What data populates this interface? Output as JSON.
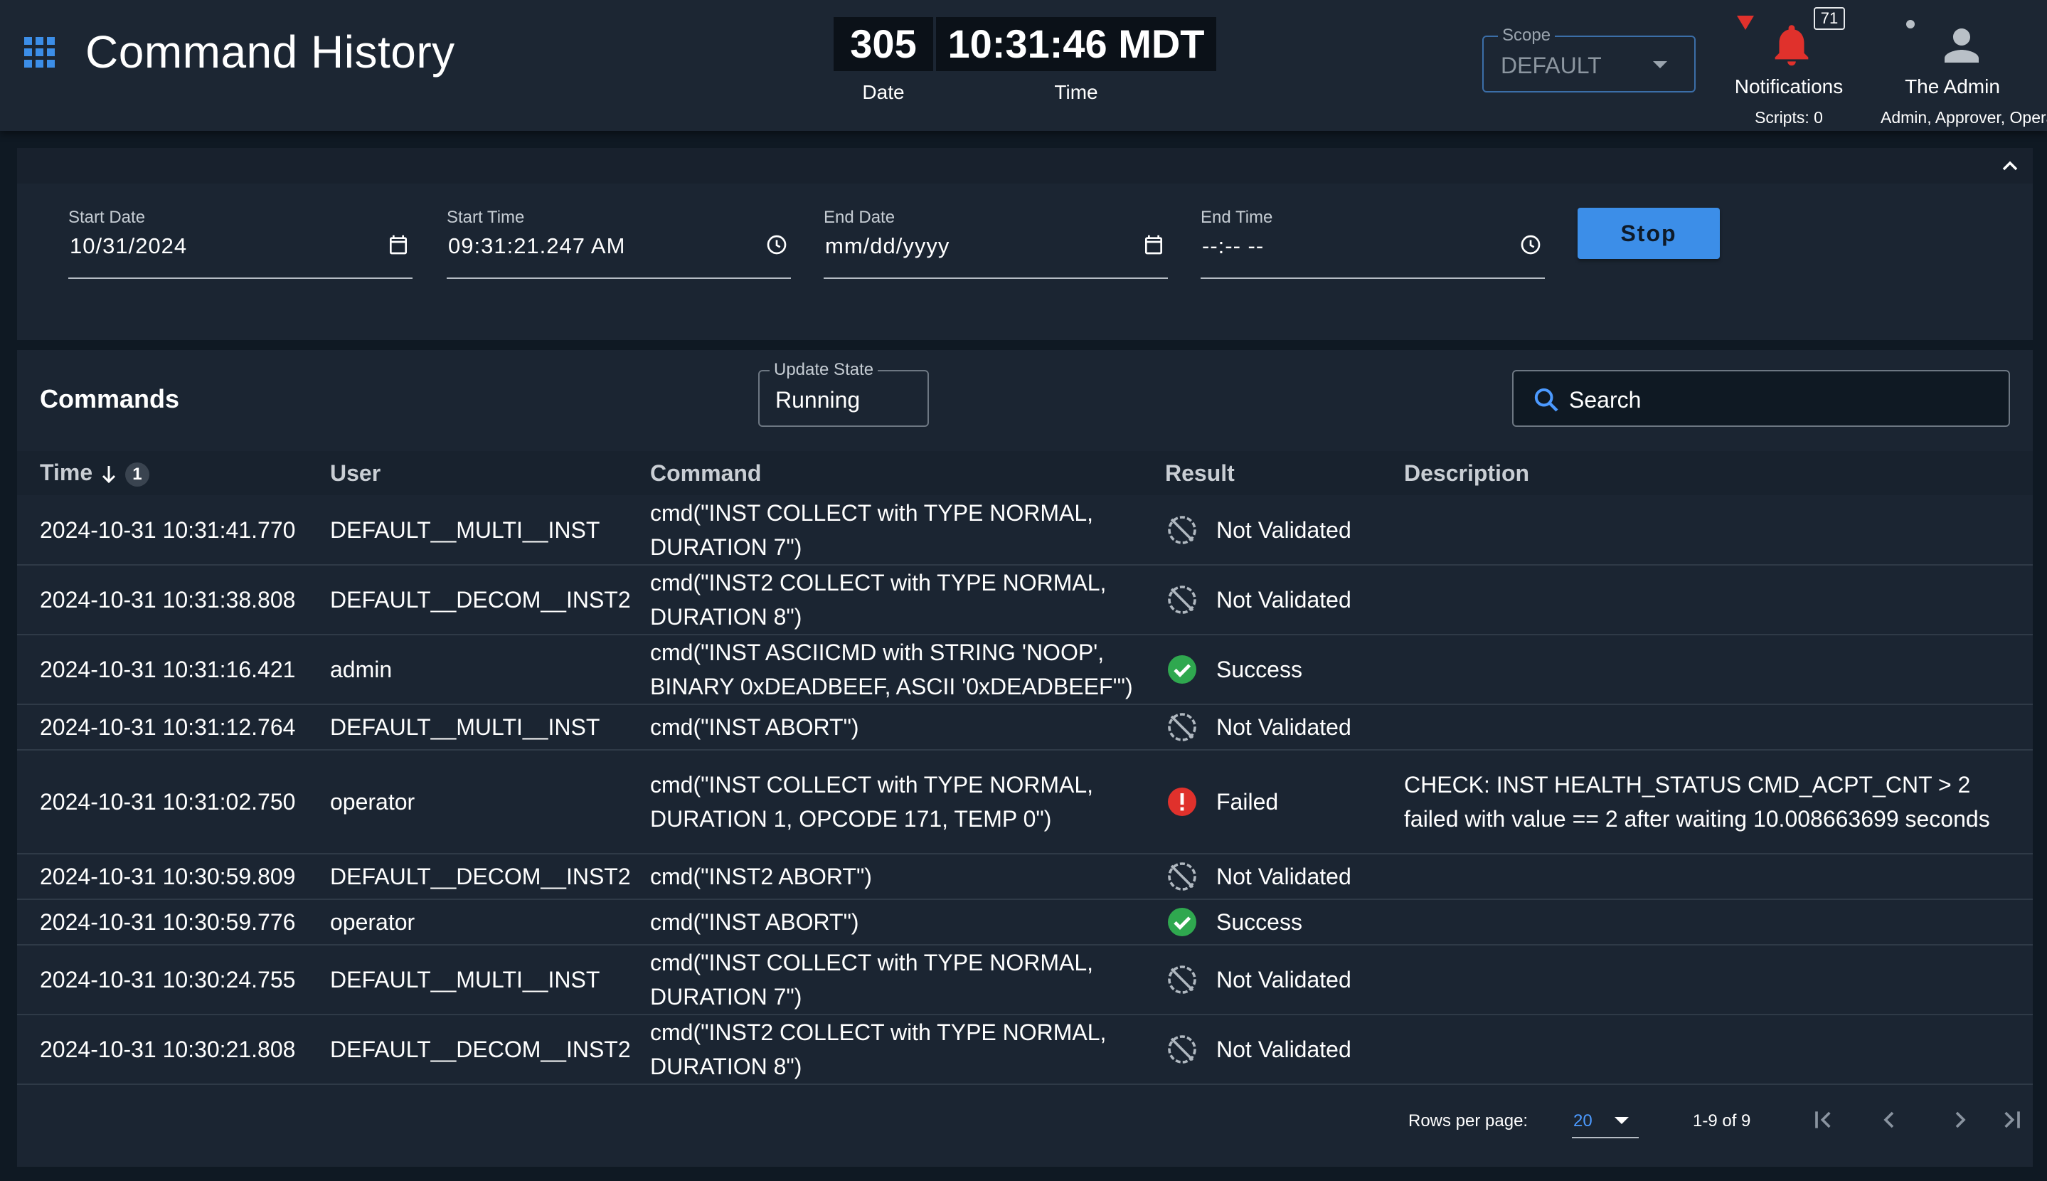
{
  "header": {
    "title": "Command History",
    "clock": {
      "date_value": "305",
      "time_value": "10:31:46 MDT",
      "date_label": "Date",
      "time_label": "Time"
    },
    "scope": {
      "label": "Scope",
      "value": "DEFAULT"
    },
    "notifications": {
      "count": "71",
      "label": "Notifications",
      "scripts": "Scripts: 0"
    },
    "user": {
      "name": "The Admin",
      "roles": "Admin, Approver, Operator"
    },
    "icons": {
      "apps": "apps-grid-icon",
      "bell": "bell-icon",
      "alert": "alert-triangle-icon",
      "avatar": "account-icon"
    }
  },
  "filters": {
    "start_date": {
      "label": "Start Date",
      "value": "10/31/2024"
    },
    "start_time": {
      "label": "Start Time",
      "value": "09:31:21.247 AM"
    },
    "end_date": {
      "label": "End Date",
      "value": "mm/dd/yyyy"
    },
    "end_time": {
      "label": "End Time",
      "value": "--:-- --"
    },
    "stop_label": "Stop"
  },
  "commands": {
    "title": "Commands",
    "update_state": {
      "label": "Update State",
      "value": "Running"
    },
    "search": {
      "placeholder": "Search"
    },
    "columns": {
      "time": "Time",
      "sort_priority": "1",
      "user": "User",
      "command": "Command",
      "result": "Result",
      "description": "Description"
    },
    "rows": [
      {
        "time": "2024-10-31 10:31:41.770",
        "user": "DEFAULT__MULTI__INST",
        "command": "cmd(\"INST COLLECT with TYPE NORMAL, DURATION 7\")",
        "result": "Not Validated",
        "description": ""
      },
      {
        "time": "2024-10-31 10:31:38.808",
        "user": "DEFAULT__DECOM__INST2",
        "command": "cmd(\"INST2 COLLECT with TYPE NORMAL, DURATION 8\")",
        "result": "Not Validated",
        "description": ""
      },
      {
        "time": "2024-10-31 10:31:16.421",
        "user": "admin",
        "command": "cmd(\"INST ASCIICMD with STRING 'NOOP', BINARY 0xDEADBEEF, ASCII '0xDEADBEEF'\")",
        "result": "Success",
        "description": ""
      },
      {
        "time": "2024-10-31 10:31:12.764",
        "user": "DEFAULT__MULTI__INST",
        "command": "cmd(\"INST ABORT\")",
        "result": "Not Validated",
        "description": ""
      },
      {
        "time": "2024-10-31 10:31:02.750",
        "user": "operator",
        "command": "cmd(\"INST COLLECT with TYPE NORMAL, DURATION 1, OPCODE 171, TEMP 0\")",
        "result": "Failed",
        "description": "CHECK: INST HEALTH_STATUS CMD_ACPT_CNT > 2 failed with value == 2 after waiting 10.008663699 seconds"
      },
      {
        "time": "2024-10-31 10:30:59.809",
        "user": "DEFAULT__DECOM__INST2",
        "command": "cmd(\"INST2 ABORT\")",
        "result": "Not Validated",
        "description": ""
      },
      {
        "time": "2024-10-31 10:30:59.776",
        "user": "operator",
        "command": "cmd(\"INST ABORT\")",
        "result": "Success",
        "description": ""
      },
      {
        "time": "2024-10-31 10:30:24.755",
        "user": "DEFAULT__MULTI__INST",
        "command": "cmd(\"INST COLLECT with TYPE NORMAL, DURATION 7\")",
        "result": "Not Validated",
        "description": ""
      },
      {
        "time": "2024-10-31 10:30:21.808",
        "user": "DEFAULT__DECOM__INST2",
        "command": "cmd(\"INST2 COLLECT with TYPE NORMAL, DURATION 8\")",
        "result": "Not Validated",
        "description": ""
      }
    ],
    "pagination": {
      "rows_per_page_label": "Rows per page:",
      "rows_per_page": "20",
      "range": "1-9 of 9"
    }
  },
  "colors": {
    "success": "#2fa84f",
    "failed": "#e0312c",
    "accent": "#3c8ee8",
    "link": "#4c9aff"
  }
}
